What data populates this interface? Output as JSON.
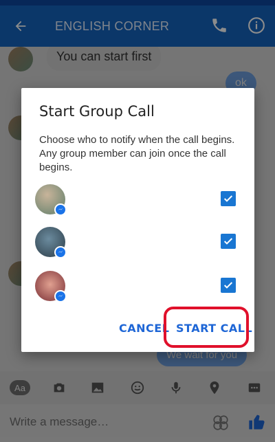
{
  "app_bar": {
    "title": "ENGLISH CORNER",
    "icons": [
      "back-arrow-icon",
      "phone-icon",
      "info-icon"
    ]
  },
  "chat": {
    "incoming_text": "You can start first",
    "outgoing_ok": "ok",
    "outgoing_partial": "We wait for you"
  },
  "dialog": {
    "title": "Start Group Call",
    "body": "Choose who to notify when the call begins. Any group member can join once the call begins.",
    "members": [
      {
        "checked": true
      },
      {
        "checked": true
      },
      {
        "checked": true
      }
    ],
    "cancel_label": "CANCEL",
    "start_label": "START CALL"
  },
  "toolbar": {
    "aa_label": "Aa",
    "icons": [
      "camera-icon",
      "gallery-icon",
      "emoji-icon",
      "microphone-icon",
      "location-icon",
      "more-icon"
    ]
  },
  "composer": {
    "placeholder": "Write a message…"
  },
  "colors": {
    "app_bar": "#1565c0",
    "accent": "#1e66d6",
    "highlight": "#e0102b"
  }
}
